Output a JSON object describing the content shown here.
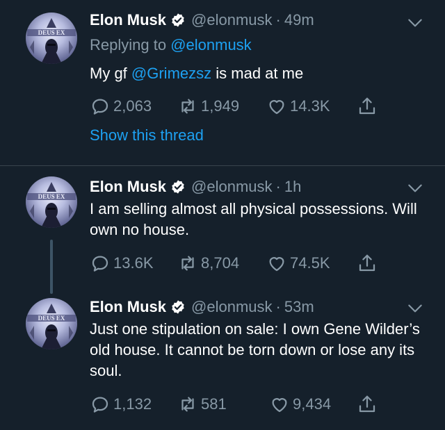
{
  "tweets": [
    {
      "name": "Elon Musk",
      "handle": "@elonmusk",
      "dot": "·",
      "time": "49m",
      "reply_prefix": "Replying to ",
      "reply_to": "@elonmusk",
      "text_before": "My gf ",
      "text_mention": "@Grimezsz",
      "text_after": " is mad at me",
      "replies": "2,063",
      "retweets": "1,949",
      "likes": "14.3K",
      "show_thread": "Show this thread"
    },
    {
      "name": "Elon Musk",
      "handle": "@elonmusk",
      "dot": "·",
      "time": "1h",
      "text": "I am selling almost all physical possessions. Will own no house.",
      "replies": "13.6K",
      "retweets": "8,704",
      "likes": "74.5K"
    },
    {
      "name": "Elon Musk",
      "handle": "@elonmusk",
      "dot": "·",
      "time": "53m",
      "text": "Just one stipulation on sale: I own Gene Wilder’s old house. It cannot be torn down or lose any its soul.",
      "replies": "1,132",
      "retweets": "581",
      "likes": "9,434"
    }
  ],
  "avatar_text": "DEUS EX",
  "icons": {
    "verified": "verified-badge-icon",
    "chevron": "chevron-down-icon",
    "reply": "reply-icon",
    "retweet": "retweet-icon",
    "like": "heart-icon",
    "share": "share-icon"
  },
  "colors": {
    "background": "#15202b",
    "secondary_text": "#8899a6",
    "link": "#1da1f2",
    "divider": "#38444d"
  }
}
